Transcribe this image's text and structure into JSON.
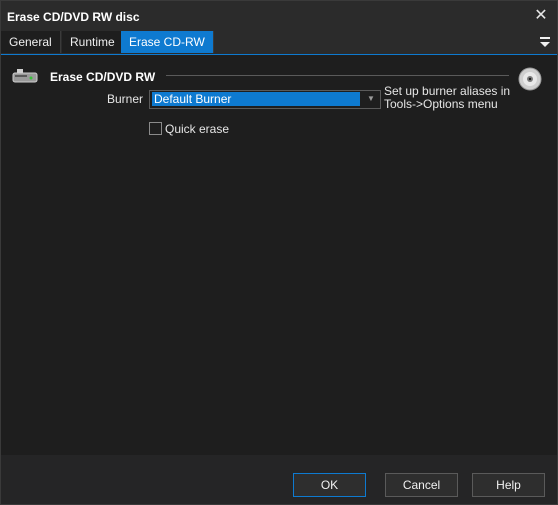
{
  "window": {
    "title": "Erase CD/DVD RW disc",
    "close_icon": "close-icon"
  },
  "tabs": [
    {
      "label": "General",
      "active": false
    },
    {
      "label": "Runtime",
      "active": false
    },
    {
      "label": "Erase CD-RW",
      "active": true
    }
  ],
  "section": {
    "title": "Erase CD/DVD RW",
    "icon": "cd-drive-icon",
    "right_icon": "disc-icon"
  },
  "burner": {
    "label": "Burner",
    "value": "Default Burner",
    "help": "Set up burner aliases in Tools->Options menu"
  },
  "quick_erase": {
    "label": "Quick erase",
    "checked": false
  },
  "buttons": {
    "ok": "OK",
    "cancel": "Cancel",
    "help": "Help"
  },
  "colors": {
    "accent": "#0e7ad0",
    "background": "#1e1e1e",
    "text": "#f0f0f0"
  }
}
